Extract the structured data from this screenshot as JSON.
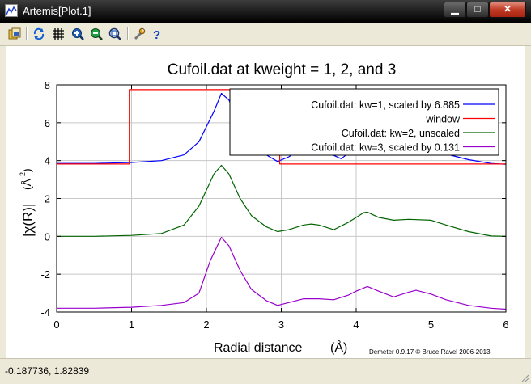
{
  "window": {
    "title": "Artemis[Plot.1]"
  },
  "toolbar": {
    "icons": [
      "save-icon",
      "refresh-icon",
      "grid-icon",
      "zoom-in-icon",
      "zoom-out-icon",
      "zoom-fit-icon",
      "settings-icon",
      "help-icon"
    ],
    "help_glyph": "?"
  },
  "chart_data": {
    "type": "line",
    "title": "Cufoil.dat at kweight = 1, 2, and 3",
    "xlabel": "Radial distance",
    "xlabel_unit": "(Å)",
    "ylabel": "|χ(R)|",
    "ylabel_unit": "(Å",
    "ylabel_unit_sup": "-2",
    "ylabel_unit_close": ")",
    "xlim": [
      0,
      6
    ],
    "ylim": [
      -4,
      8
    ],
    "xticks": [
      "0",
      "1",
      "2",
      "3",
      "4",
      "5",
      "6"
    ],
    "yticks": [
      "-4",
      "-2",
      "0",
      "2",
      "4",
      "6",
      "8"
    ],
    "grid": true,
    "legend_position": "top-right",
    "credit": "Demeter 0.9.17 © Bruce Ravel 2006-2013",
    "series": [
      {
        "name": "Cufoil.dat: kw=1, scaled by 6.885",
        "color": "#0000ff",
        "x": [
          0,
          0.5,
          1.0,
          1.4,
          1.7,
          1.9,
          2.1,
          2.2,
          2.3,
          2.45,
          2.6,
          2.8,
          2.95,
          3.1,
          3.2,
          3.4,
          3.6,
          3.8,
          3.95,
          4.1,
          4.2,
          4.4,
          4.5,
          4.7,
          4.8,
          5.0,
          5.2,
          5.5,
          5.8,
          6.0
        ],
        "y": [
          3.85,
          3.85,
          3.9,
          4.0,
          4.3,
          5.0,
          6.6,
          7.55,
          7.2,
          5.8,
          4.9,
          4.3,
          3.95,
          4.2,
          4.45,
          4.6,
          4.45,
          4.1,
          4.55,
          5.1,
          5.15,
          4.9,
          4.75,
          4.95,
          4.8,
          4.55,
          4.35,
          4.05,
          3.85,
          3.8
        ]
      },
      {
        "name": "window",
        "color": "#ff0000",
        "x": [
          0,
          0.97,
          0.97,
          2.98,
          2.98,
          6.0
        ],
        "y": [
          3.82,
          3.82,
          7.75,
          7.75,
          3.82,
          3.82
        ]
      },
      {
        "name": "Cufoil.dat: kw=2, unscaled",
        "color": "#006400",
        "x": [
          0,
          0.5,
          1.0,
          1.4,
          1.7,
          1.9,
          2.1,
          2.2,
          2.3,
          2.45,
          2.6,
          2.8,
          2.95,
          3.1,
          3.3,
          3.4,
          3.5,
          3.7,
          3.9,
          4.1,
          4.15,
          4.3,
          4.5,
          4.7,
          5.0,
          5.2,
          5.5,
          5.8,
          6.0
        ],
        "y": [
          0.0,
          0.0,
          0.05,
          0.15,
          0.6,
          1.6,
          3.3,
          3.75,
          3.3,
          2.0,
          1.1,
          0.5,
          0.25,
          0.35,
          0.6,
          0.65,
          0.6,
          0.35,
          0.75,
          1.25,
          1.28,
          1.0,
          0.85,
          0.9,
          0.85,
          0.6,
          0.25,
          0.02,
          0.0
        ]
      },
      {
        "name": "Cufoil.dat: kw=3, scaled by 0.131",
        "color": "#9900cc",
        "x": [
          0,
          0.5,
          1.0,
          1.4,
          1.7,
          1.9,
          2.05,
          2.2,
          2.3,
          2.45,
          2.6,
          2.8,
          2.95,
          3.1,
          3.3,
          3.5,
          3.7,
          3.9,
          4.0,
          4.15,
          4.3,
          4.5,
          4.7,
          4.8,
          5.0,
          5.2,
          5.5,
          5.8,
          6.0
        ],
        "y": [
          -3.8,
          -3.8,
          -3.75,
          -3.65,
          -3.5,
          -3.0,
          -1.3,
          -0.05,
          -0.5,
          -1.8,
          -2.8,
          -3.4,
          -3.65,
          -3.5,
          -3.3,
          -3.3,
          -3.35,
          -3.1,
          -2.9,
          -2.65,
          -2.9,
          -3.2,
          -2.95,
          -2.85,
          -3.05,
          -3.35,
          -3.65,
          -3.8,
          -3.85
        ]
      }
    ]
  },
  "status": {
    "coords": "-0.187736,  1.82839"
  }
}
